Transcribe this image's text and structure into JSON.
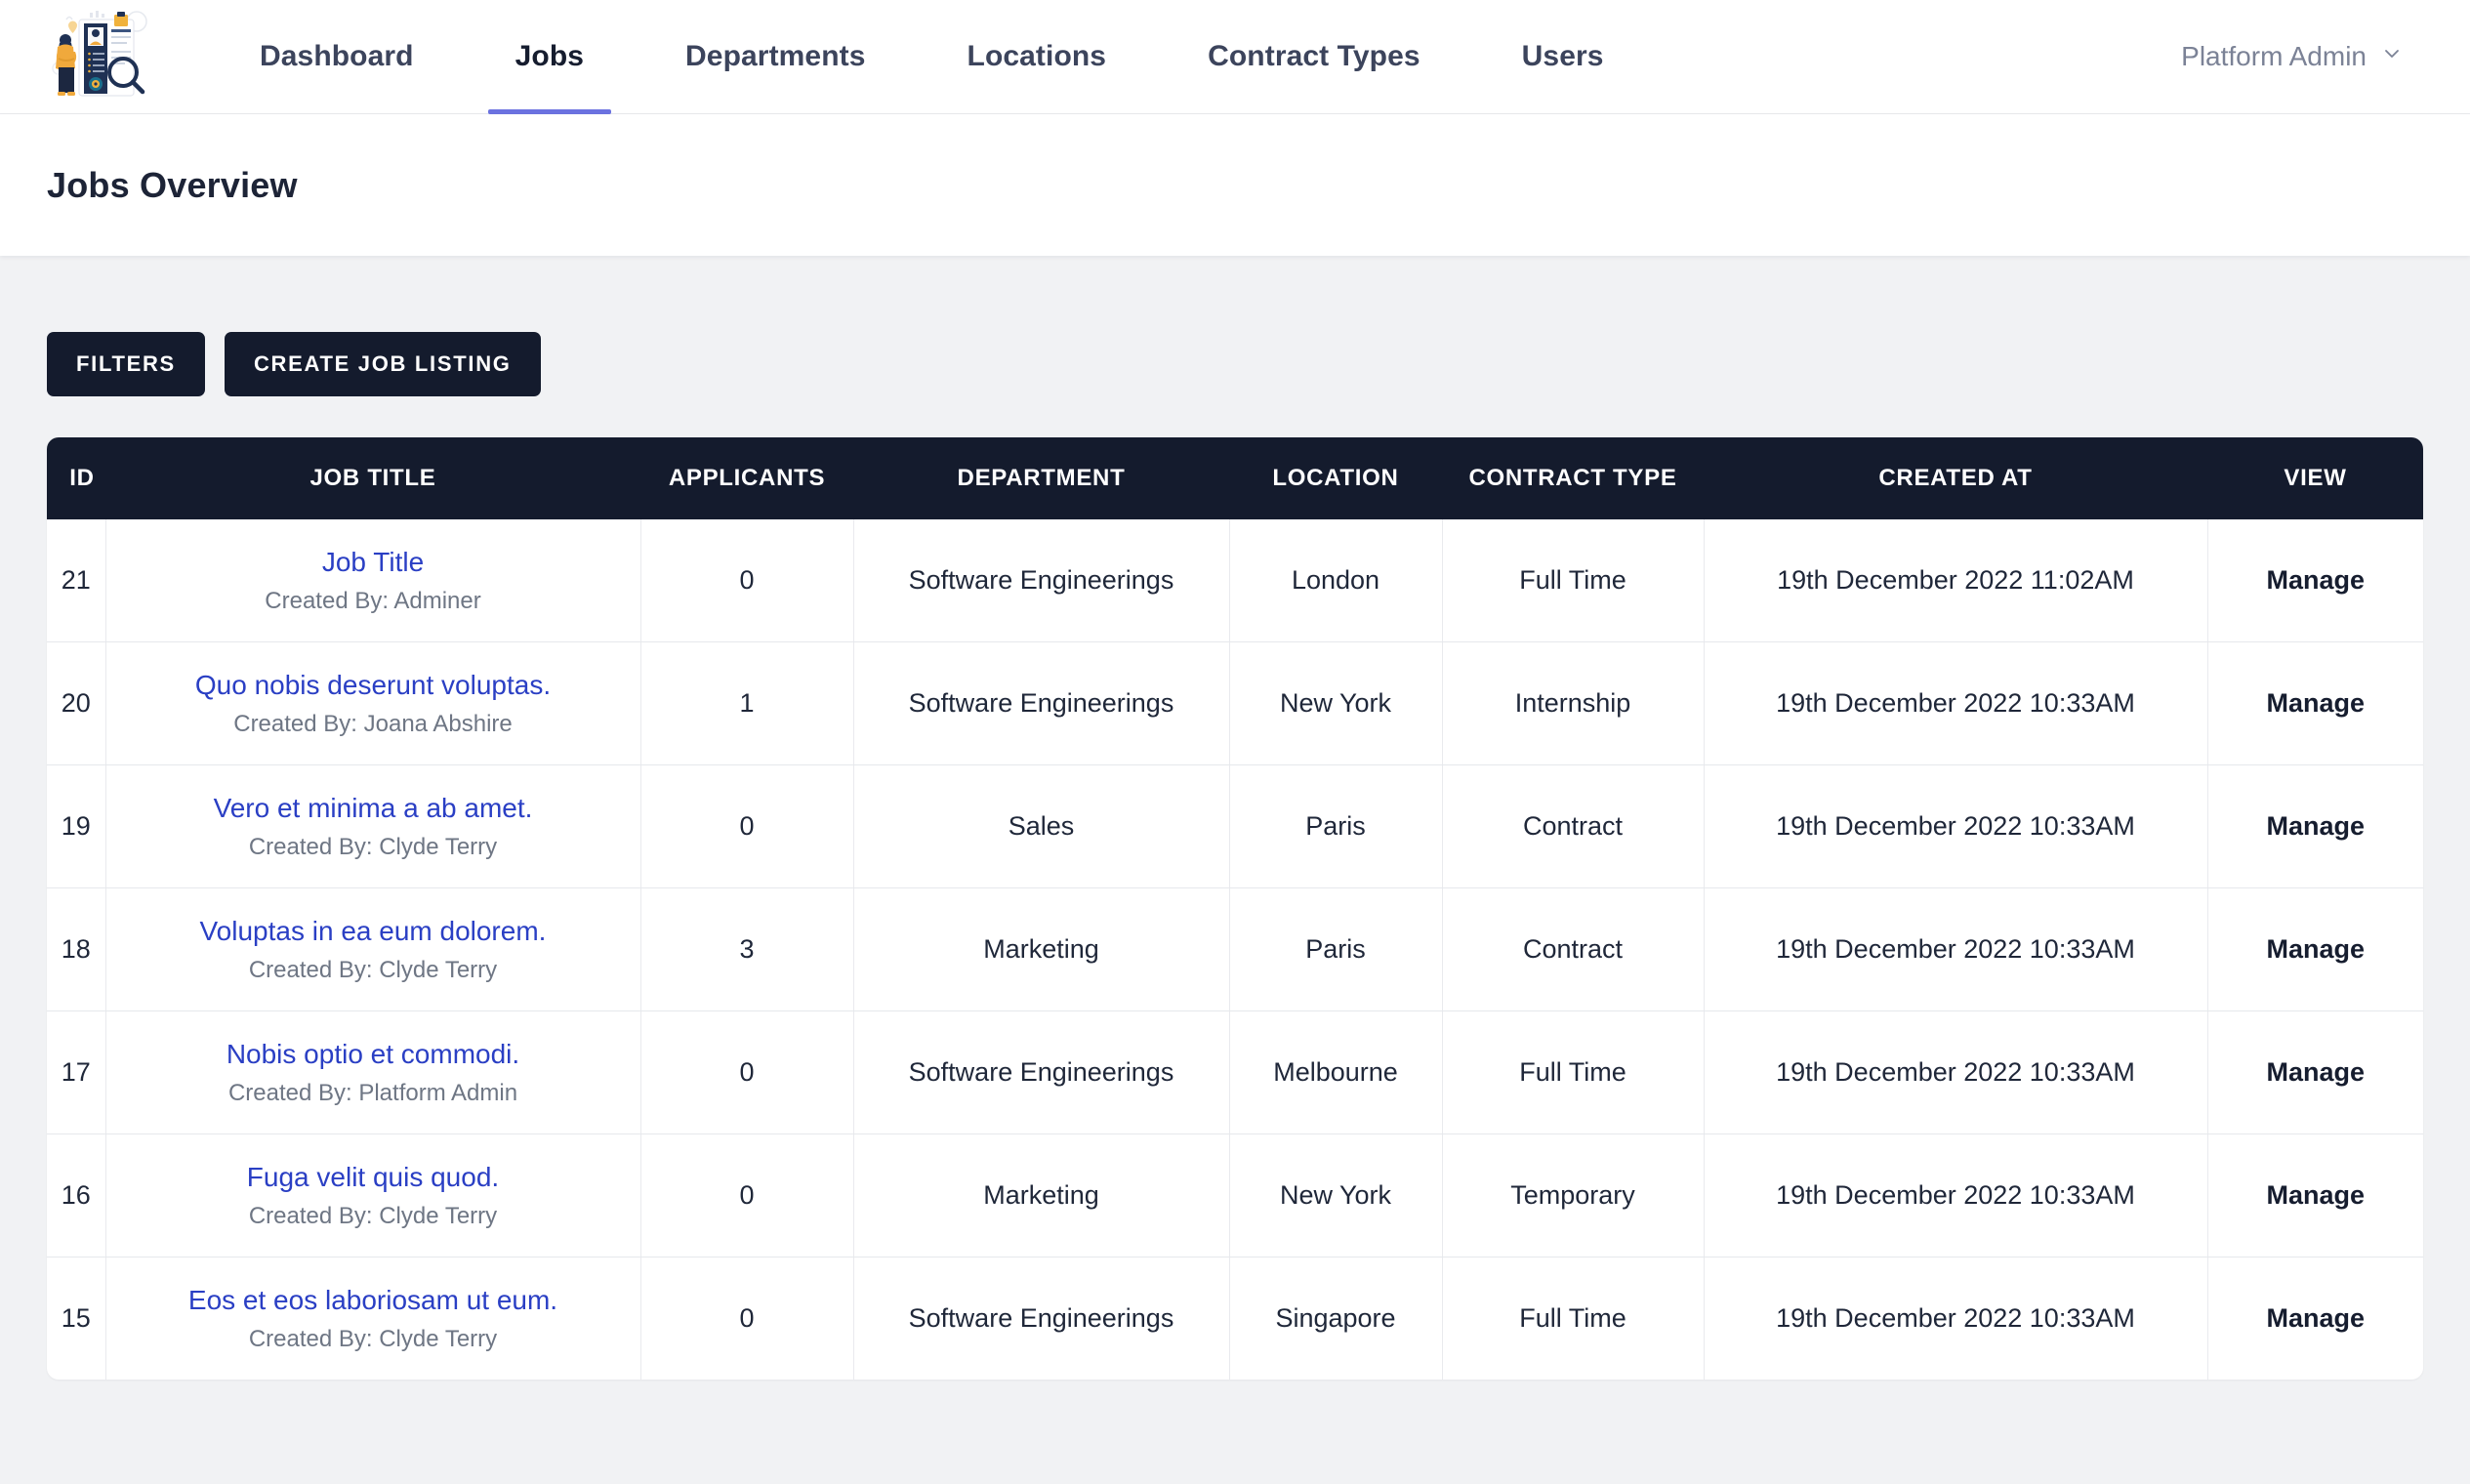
{
  "nav": {
    "logo_name": "job-search-illustration-logo",
    "items": [
      {
        "label": "Dashboard",
        "active": false
      },
      {
        "label": "Jobs",
        "active": true
      },
      {
        "label": "Departments",
        "active": false
      },
      {
        "label": "Locations",
        "active": false
      },
      {
        "label": "Contract Types",
        "active": false
      },
      {
        "label": "Users",
        "active": false
      }
    ],
    "user": {
      "label": "Platform Admin",
      "caret_icon": "chevron-down-icon"
    },
    "active_underline_color": "#6b72e0"
  },
  "page": {
    "title": "Jobs Overview"
  },
  "toolbar": {
    "filters_label": "FILTERS",
    "create_label": "CREATE JOB LISTING",
    "button_color": "#141b2d"
  },
  "table": {
    "header_bg": "#141b2d",
    "link_color": "#2a3fc4",
    "columns": [
      "ID",
      "JOB TITLE",
      "APPLICANTS",
      "DEPARTMENT",
      "LOCATION",
      "CONTRACT TYPE",
      "CREATED AT",
      "VIEW"
    ],
    "rows": [
      {
        "id": "21",
        "title": "Job Title",
        "created_by": "Created By: Adminer",
        "applicants": "0",
        "department": "Software Engineerings",
        "location": "London",
        "contract_type": "Full Time",
        "created_at": "19th December 2022 11:02AM",
        "view": "Manage"
      },
      {
        "id": "20",
        "title": "Quo nobis deserunt voluptas.",
        "created_by": "Created By: Joana Abshire",
        "applicants": "1",
        "department": "Software Engineerings",
        "location": "New York",
        "contract_type": "Internship",
        "created_at": "19th December 2022 10:33AM",
        "view": "Manage"
      },
      {
        "id": "19",
        "title": "Vero et minima a ab amet.",
        "created_by": "Created By: Clyde Terry",
        "applicants": "0",
        "department": "Sales",
        "location": "Paris",
        "contract_type": "Contract",
        "created_at": "19th December 2022 10:33AM",
        "view": "Manage"
      },
      {
        "id": "18",
        "title": "Voluptas in ea eum dolorem.",
        "created_by": "Created By: Clyde Terry",
        "applicants": "3",
        "department": "Marketing",
        "location": "Paris",
        "contract_type": "Contract",
        "created_at": "19th December 2022 10:33AM",
        "view": "Manage"
      },
      {
        "id": "17",
        "title": "Nobis optio et commodi.",
        "created_by": "Created By: Platform Admin",
        "applicants": "0",
        "department": "Software Engineerings",
        "location": "Melbourne",
        "contract_type": "Full Time",
        "created_at": "19th December 2022 10:33AM",
        "view": "Manage"
      },
      {
        "id": "16",
        "title": "Fuga velit quis quod.",
        "created_by": "Created By: Clyde Terry",
        "applicants": "0",
        "department": "Marketing",
        "location": "New York",
        "contract_type": "Temporary",
        "created_at": "19th December 2022 10:33AM",
        "view": "Manage"
      },
      {
        "id": "15",
        "title": "Eos et eos laboriosam ut eum.",
        "created_by": "Created By: Clyde Terry",
        "applicants": "0",
        "department": "Software Engineerings",
        "location": "Singapore",
        "contract_type": "Full Time",
        "created_at": "19th December 2022 10:33AM",
        "view": "Manage"
      }
    ]
  }
}
